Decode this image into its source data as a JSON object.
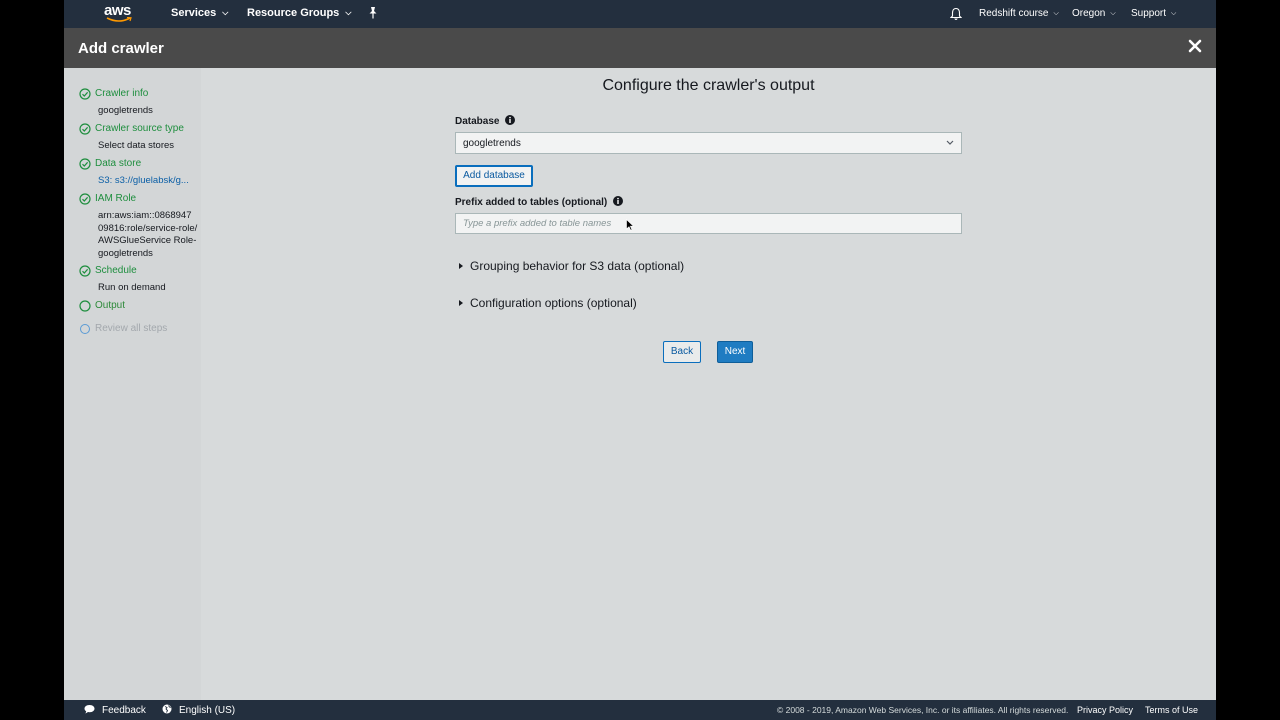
{
  "nav": {
    "logo_text": "aws",
    "services": "Services",
    "resource_groups": "Resource Groups",
    "account": "Redshift course",
    "region": "Oregon",
    "support": "Support",
    "colors": {
      "bar": "#232f3e",
      "logo_smile": "#ff9900"
    }
  },
  "header": {
    "title": "Add crawler"
  },
  "sidebar": {
    "steps": [
      {
        "label": "Crawler info",
        "detail": "googletrends",
        "status": "complete"
      },
      {
        "label": "Crawler source type",
        "detail": "Select data stores",
        "status": "complete"
      },
      {
        "label": "Data store",
        "detail": "S3: s3://gluelabsk/g...",
        "status": "complete"
      },
      {
        "label": "IAM Role",
        "detail": "arn:aws:iam::0868947 09816:role/service-role/AWSGlueService Role-googletrends",
        "status": "complete"
      },
      {
        "label": "Schedule",
        "detail": "Run on demand",
        "status": "complete"
      },
      {
        "label": "Output",
        "detail": "",
        "status": "current"
      },
      {
        "label": "Review all steps",
        "detail": "",
        "status": "disabled"
      }
    ]
  },
  "main": {
    "heading": "Configure the crawler's output",
    "database_label": "Database",
    "database_value": "googletrends",
    "add_database": "Add database",
    "prefix_label": "Prefix added to tables (optional)",
    "prefix_placeholder": "Type a prefix added to table names",
    "prefix_value": "",
    "grouping": "Grouping behavior for S3 data (optional)",
    "config_options": "Configuration options (optional)",
    "back": "Back",
    "next": "Next"
  },
  "footer": {
    "feedback": "Feedback",
    "language": "English (US)",
    "copyright": "© 2008 - 2019, Amazon Web Services, Inc. or its affiliates. All rights reserved.",
    "privacy": "Privacy Policy",
    "terms": "Terms of Use"
  }
}
